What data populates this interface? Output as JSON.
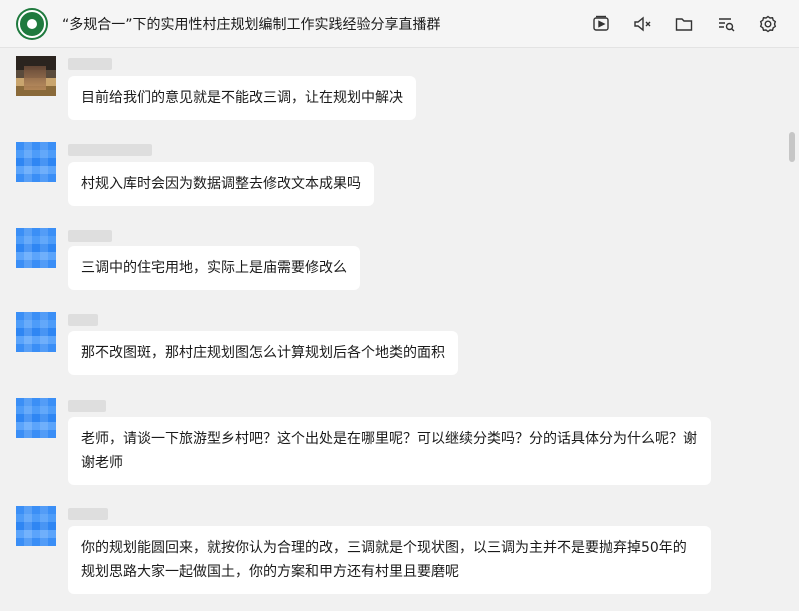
{
  "header": {
    "title": "“多规合一”下的实用性村庄规划编制工作实践经验分享直播群",
    "icons": [
      "live-icon",
      "mute-icon",
      "folder-icon",
      "search-chat-icon",
      "settings-icon"
    ]
  },
  "messages": [
    {
      "avatar": "photo",
      "text": "目前给我们的意见就是不能改三调，让在规划中解决"
    },
    {
      "avatar": "blue",
      "text": "村规入库时会因为数据调整去修改文本成果吗"
    },
    {
      "avatar": "blue",
      "text": "三调中的住宅用地，实际上是庙需要修改么"
    },
    {
      "avatar": "blue",
      "text": "那不改图斑，那村庄规划图怎么计算规划后各个地类的面积"
    },
    {
      "avatar": "blue",
      "text": "老师，请谈一下旅游型乡村吧？这个出处是在哪里呢？可以继续分类吗？分的话具体分为什么呢？谢谢老师"
    },
    {
      "avatar": "blue",
      "text": "你的规划能圆回来，就按你认为合理的改，三调就是个现状图，以三调为主并不是要抛弃掉50年的规划思路大家一起做国土，你的方案和甲方还有村里且要磨呢"
    }
  ],
  "colors": {
    "background": "#f1f1f1",
    "bubble": "#ffffff",
    "avatar_blue": "#3a8ef6",
    "group_avatar": "#1f7a3e"
  }
}
